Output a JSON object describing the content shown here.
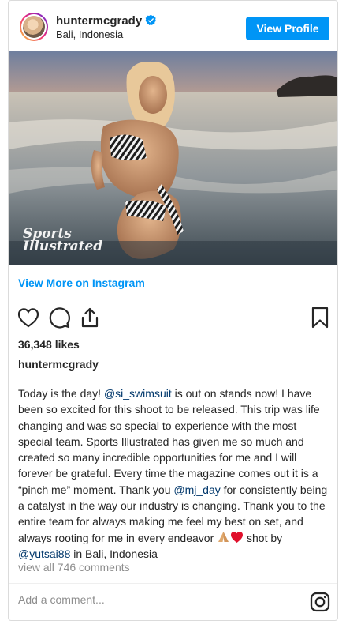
{
  "header": {
    "username": "huntermcgrady",
    "location": "Bali, Indonesia",
    "view_profile_label": "View Profile"
  },
  "post": {
    "view_more_label": "View More on Instagram",
    "likes": "36,348 likes",
    "author": "huntermcgrady",
    "caption": {
      "t1": "Today is the day! ",
      "m1": "@si_swimsuit",
      "t2": " is out on stands now! I have been so excited for this shoot to be released. This trip was life changing and was so special to experience with the most special team. Sports Illustrated has given me so much and created so many incredible opportunities for me and I will forever be grateful. Every time the magazine comes out it is a “pinch me” moment. Thank you ",
      "m2": "@mj_day",
      "t3": " for consistently being a catalyst in the way our industry is changing. Thank you to the entire team for always making me feel my best on set, and always rooting for me in every endeavor ",
      "t4": " shot by ",
      "m3": "@yutsai88",
      "t5": " in Bali, Indonesia"
    },
    "view_comments": "view all 746 comments",
    "add_comment_placeholder": "Add a comment...",
    "watermark": "Sports Illustrated"
  },
  "icons": {
    "verified": "verified-badge-icon",
    "like": "heart-icon",
    "comment": "comment-bubble-icon",
    "share": "share-icon",
    "save": "bookmark-icon",
    "instagram": "instagram-logo-icon"
  },
  "colors": {
    "accent": "#0095f6",
    "mention": "#00376b",
    "muted": "#8e8e8e"
  }
}
